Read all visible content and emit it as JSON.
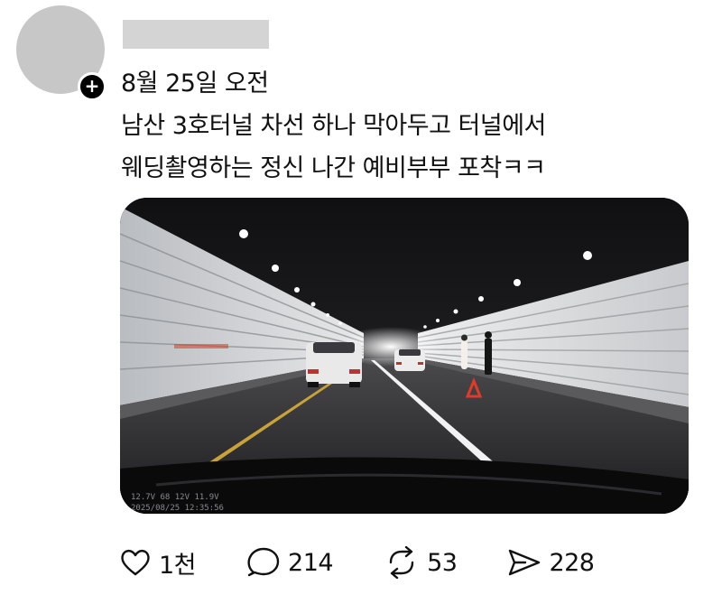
{
  "post": {
    "timestamp": "8월 25일 오전",
    "text_lines": [
      "남산 3호터널 차선 하나 막아두고 터널에서",
      "웨딩촬영하는 정신 나간 예비부부 포착ㅋㅋ"
    ]
  },
  "media": {
    "type": "dashcam-photo",
    "overlay_readout_1": "12.7V   68   12V   11.9V",
    "overlay_readout_2": "2025/08/25  12:35:56"
  },
  "actions": {
    "like": {
      "icon": "heart-icon",
      "count": "1천"
    },
    "reply": {
      "icon": "speech-bubble-icon",
      "count": "214"
    },
    "repost": {
      "icon": "repost-arrows-icon",
      "count": "53"
    },
    "share": {
      "icon": "paper-plane-icon",
      "count": "228"
    }
  }
}
